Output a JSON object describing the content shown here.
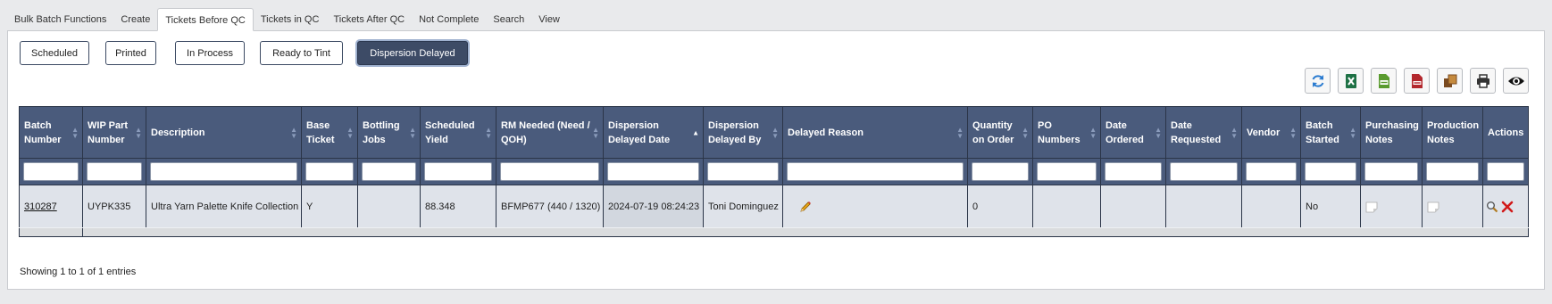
{
  "tabs": [
    {
      "label": "Bulk Batch Functions"
    },
    {
      "label": "Create"
    },
    {
      "label": "Tickets Before QC",
      "active": true
    },
    {
      "label": "Tickets in QC"
    },
    {
      "label": "Tickets After QC"
    },
    {
      "label": "Not Complete"
    },
    {
      "label": "Search"
    },
    {
      "label": "View"
    }
  ],
  "sub_buttons": {
    "scheduled": "Scheduled",
    "printed": "Printed",
    "in_process": "In Process",
    "ready_to_tint": "Ready to Tint",
    "dispersion_delayed": "Dispersion Delayed",
    "active": "dispersion_delayed"
  },
  "toolbar": {
    "icons": [
      "refresh-icon",
      "excel-icon",
      "csv-icon",
      "pdf-icon",
      "copy-icon",
      "print-icon",
      "eye-icon"
    ],
    "colors": {
      "refresh": "#2a7bd0",
      "excel": "#1e7145",
      "csv": "#5a9b2f",
      "pdf": "#b3282d",
      "copy": "#7a4a1f"
    }
  },
  "columns": {
    "batch_number": "Batch Number",
    "wip_part_number": "WIP Part Number",
    "description": "Description",
    "base_ticket": "Base Ticket",
    "bottling_jobs": "Bottling Jobs",
    "scheduled_yield": "Scheduled Yield",
    "rm_needed": "RM Needed (Need / QOH)",
    "dispersion_delayed_date": "Dispersion Delayed Date",
    "dispersion_delayed_by": "Dispersion Delayed By",
    "delayed_reason": "Delayed Reason",
    "quantity_on_order": "Quantity on Order",
    "po_numbers": "PO Numbers",
    "date_ordered": "Date Ordered",
    "date_requested": "Date Requested",
    "vendor": "Vendor",
    "batch_started": "Batch Started",
    "purchasing_notes": "Purchasing Notes",
    "production_notes": "Production Notes",
    "actions": "Actions"
  },
  "rows": [
    {
      "batch_number": "310287",
      "wip_part_number": "UYPK335",
      "description": "Ultra Yarn Palette Knife Collection",
      "base_ticket": "Y",
      "bottling_jobs": "",
      "scheduled_yield": "88.348",
      "rm_needed": "BFMP677 (440 / 1320)",
      "dispersion_delayed_date": "2024-07-19 08:24:23",
      "dispersion_delayed_by": "Toni Dominguez",
      "delayed_reason": "",
      "quantity_on_order": "0",
      "po_numbers": "",
      "date_ordered": "",
      "date_requested": "",
      "vendor": "",
      "batch_started": "No"
    }
  ],
  "info": "Showing 1 to 1 of 1 entries",
  "colors": {
    "header": "#4a5b7c",
    "row": "#dfe3ea",
    "active_button": "#3d4b66"
  }
}
